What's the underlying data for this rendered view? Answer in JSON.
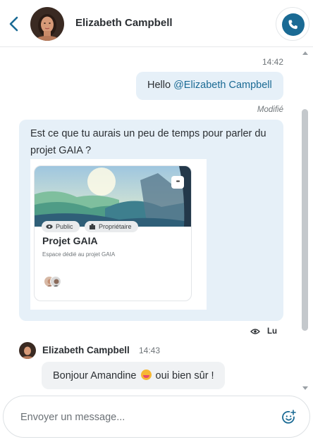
{
  "header": {
    "contact_name": "Elizabeth Campbell"
  },
  "messages": {
    "outgoing_time": "14:42",
    "outgoing_prefix": "Hello ",
    "outgoing_mention": "@Elizabeth Campbell",
    "edited_label": "Modifié",
    "big_message_text": "Est ce que tu aurais un peu de temps pour parler du projet GAIA ?",
    "card": {
      "tag_public": "Public",
      "tag_owner": "Propriétaire",
      "title": "Projet GAIA",
      "description": "Espace dédié au projet GAIA",
      "menu_glyph": "•••"
    },
    "read_label": "Lu",
    "incoming": {
      "sender": "Elizabeth Campbell",
      "time": "14:43",
      "text_before_emoji": "Bonjour Amandine ",
      "text_after_emoji": " oui bien sûr !"
    }
  },
  "composer": {
    "placeholder": "Envoyer un message..."
  },
  "colors": {
    "accent": "#1a6a94",
    "bubble_out": "#e6f0f8",
    "bubble_in": "#f0f2f4"
  },
  "icons": [
    "back-icon",
    "phone-icon",
    "eye-icon",
    "building-icon",
    "more-icon",
    "emoji-add-icon"
  ]
}
